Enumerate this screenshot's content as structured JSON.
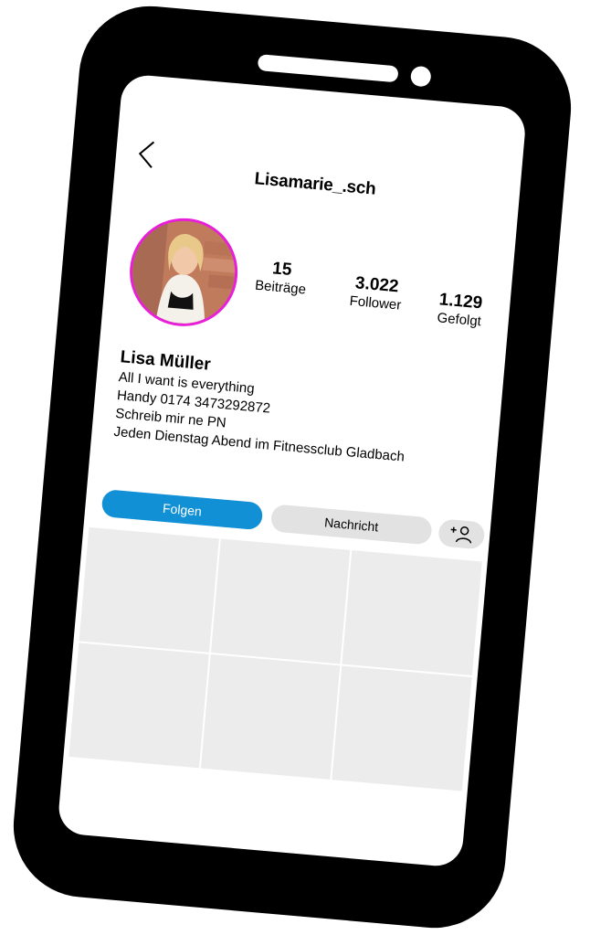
{
  "profile": {
    "username": "Lisamarie_.sch",
    "name": "Lisa Müller",
    "bio": [
      "All I want is everything",
      "Handy 0174 3473292872",
      "Schreib mir ne PN",
      "Jeden Dienstag Abend im Fitnessclub Gladbach"
    ],
    "avatar_ring_color": "#e81ed8"
  },
  "stats": {
    "posts": {
      "value": "15",
      "label": "Beiträge"
    },
    "followers": {
      "value": "3.022",
      "label": "Follower"
    },
    "following": {
      "value": "1.129",
      "label": "Gefolgt"
    }
  },
  "actions": {
    "follow_label": "Folgen",
    "message_label": "Nachricht",
    "follow_color": "#1190d6",
    "secondary_color": "#e2e2e2"
  },
  "icons": {
    "back": "chevron-left-icon",
    "add_user": "add-person-icon"
  },
  "posts_grid": {
    "cell_count": 6,
    "cell_color": "#ececec"
  }
}
